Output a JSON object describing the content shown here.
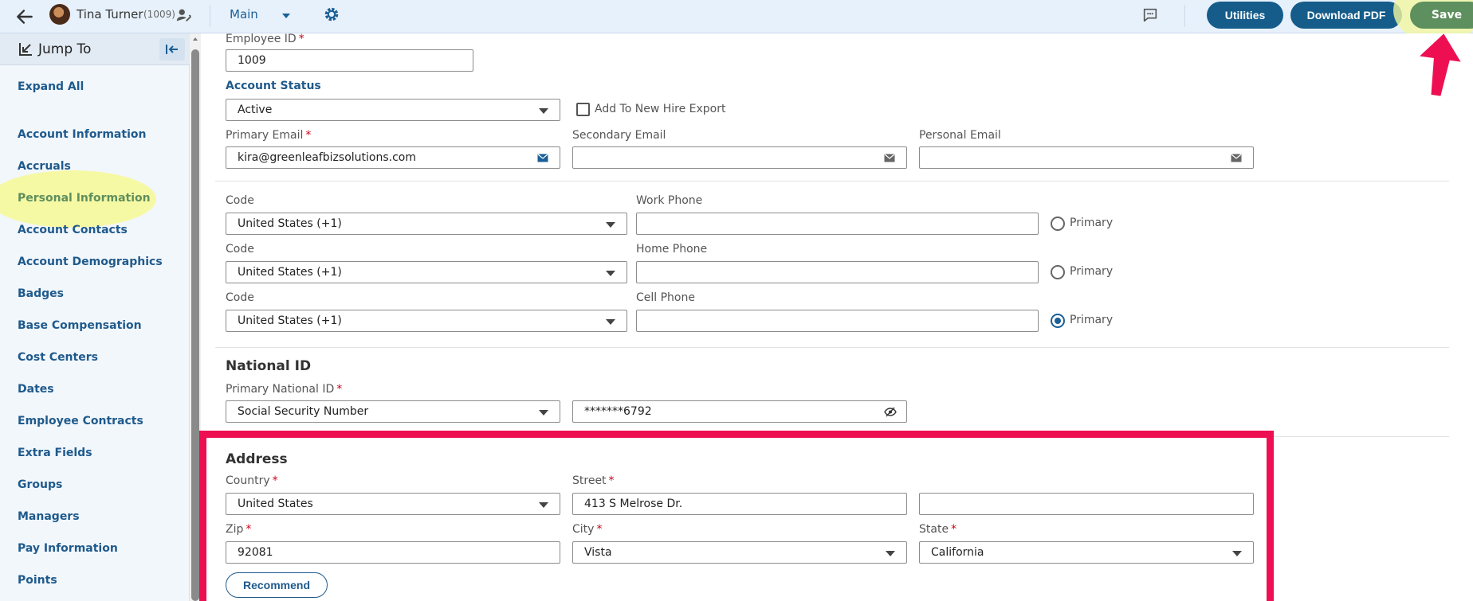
{
  "topbar": {
    "user_name": "Tina Turner",
    "user_id": "(1009)",
    "view": "Main",
    "buttons": {
      "utilities": "Utilities",
      "download_pdf": "Download PDF",
      "save": "Save"
    }
  },
  "sidebar": {
    "title": "Jump To",
    "expand_all": "Expand All",
    "items": [
      "Account Information",
      "Accruals",
      "Personal Information",
      "Account Contacts",
      "Account Demographics",
      "Badges",
      "Base Compensation",
      "Cost Centers",
      "Dates",
      "Employee Contracts",
      "Extra Fields",
      "Groups",
      "Managers",
      "Pay Information",
      "Points"
    ],
    "active_item": "Personal Information"
  },
  "form": {
    "employee_id": {
      "label": "Employee ID",
      "value": "1009"
    },
    "account_status": {
      "label": "Account Status",
      "value": "Active"
    },
    "new_hire_export": {
      "label": "Add To New Hire Export",
      "checked": false
    },
    "primary_email": {
      "label": "Primary Email",
      "value": "kira@greenleafbizsolutions.com"
    },
    "secondary_email": {
      "label": "Secondary Email",
      "value": ""
    },
    "personal_email": {
      "label": "Personal Email",
      "value": ""
    },
    "phones": [
      {
        "code_label": "Code",
        "code_value": "United States (+1)",
        "label": "Work Phone",
        "value": "",
        "primary_label": "Primary",
        "primary": false
      },
      {
        "code_label": "Code",
        "code_value": "United States (+1)",
        "label": "Home Phone",
        "value": "",
        "primary_label": "Primary",
        "primary": false
      },
      {
        "code_label": "Code",
        "code_value": "United States (+1)",
        "label": "Cell Phone",
        "value": "",
        "primary_label": "Primary",
        "primary": true
      }
    ],
    "national_id": {
      "title": "National ID",
      "label": "Primary National ID",
      "type": "Social Security Number",
      "value": "*******6792"
    },
    "address": {
      "title": "Address",
      "country_label": "Country",
      "country": "United States",
      "street_label": "Street",
      "street": "413 S Melrose Dr.",
      "street2": "",
      "zip_label": "Zip",
      "zip": "92081",
      "city_label": "City",
      "city": "Vista",
      "state_label": "State",
      "state": "California",
      "recommend": "Recommend"
    }
  },
  "colors": {
    "brand_blue": "#155c8a",
    "save_green": "#5e8f5e",
    "highlight_red": "#ee0f52",
    "highlight_yellow": "#f6f9a3"
  }
}
